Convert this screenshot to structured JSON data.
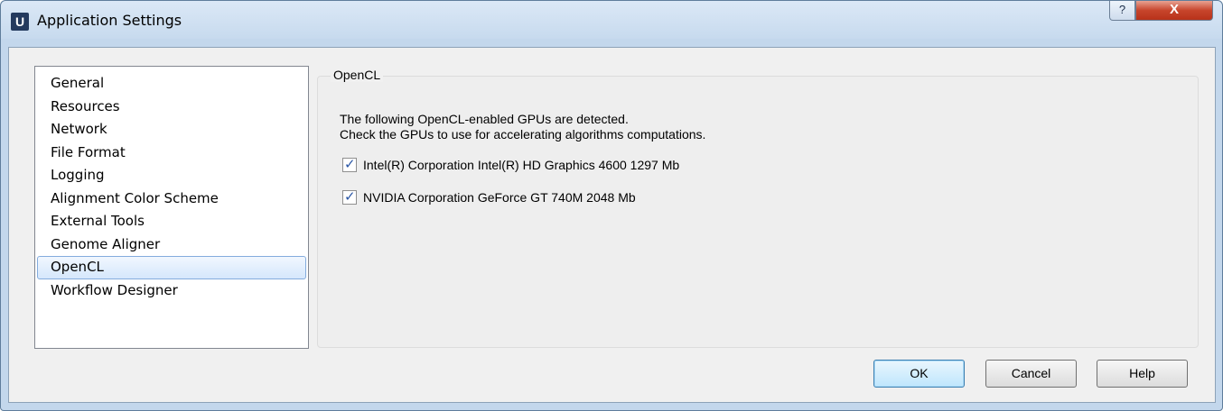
{
  "window": {
    "title": "Application Settings",
    "app_icon_letter": "U",
    "help_glyph": "?",
    "close_glyph": "X"
  },
  "sidebar": {
    "items": [
      {
        "label": "General"
      },
      {
        "label": "Resources"
      },
      {
        "label": "Network"
      },
      {
        "label": "File Format"
      },
      {
        "label": "Logging"
      },
      {
        "label": "Alignment Color Scheme"
      },
      {
        "label": "External Tools"
      },
      {
        "label": "Genome Aligner"
      },
      {
        "label": "OpenCL",
        "selected": true
      },
      {
        "label": "Workflow Designer"
      }
    ]
  },
  "panel": {
    "group_title": "OpenCL",
    "description_line1": "The following OpenCL-enabled GPUs are detected.",
    "description_line2": "Check the GPUs to use for accelerating algorithms computations.",
    "gpus": [
      {
        "label": "Intel(R) Corporation Intel(R) HD Graphics 4600 1297 Mb",
        "checked": true
      },
      {
        "label": "NVIDIA Corporation GeForce GT 740M 2048 Mb",
        "checked": true
      }
    ]
  },
  "buttons": {
    "ok": "OK",
    "cancel": "Cancel",
    "help": "Help"
  },
  "colors": {
    "frame": "#c3d7ec",
    "close_button": "#c7452c",
    "selection_border": "#84acdd"
  }
}
